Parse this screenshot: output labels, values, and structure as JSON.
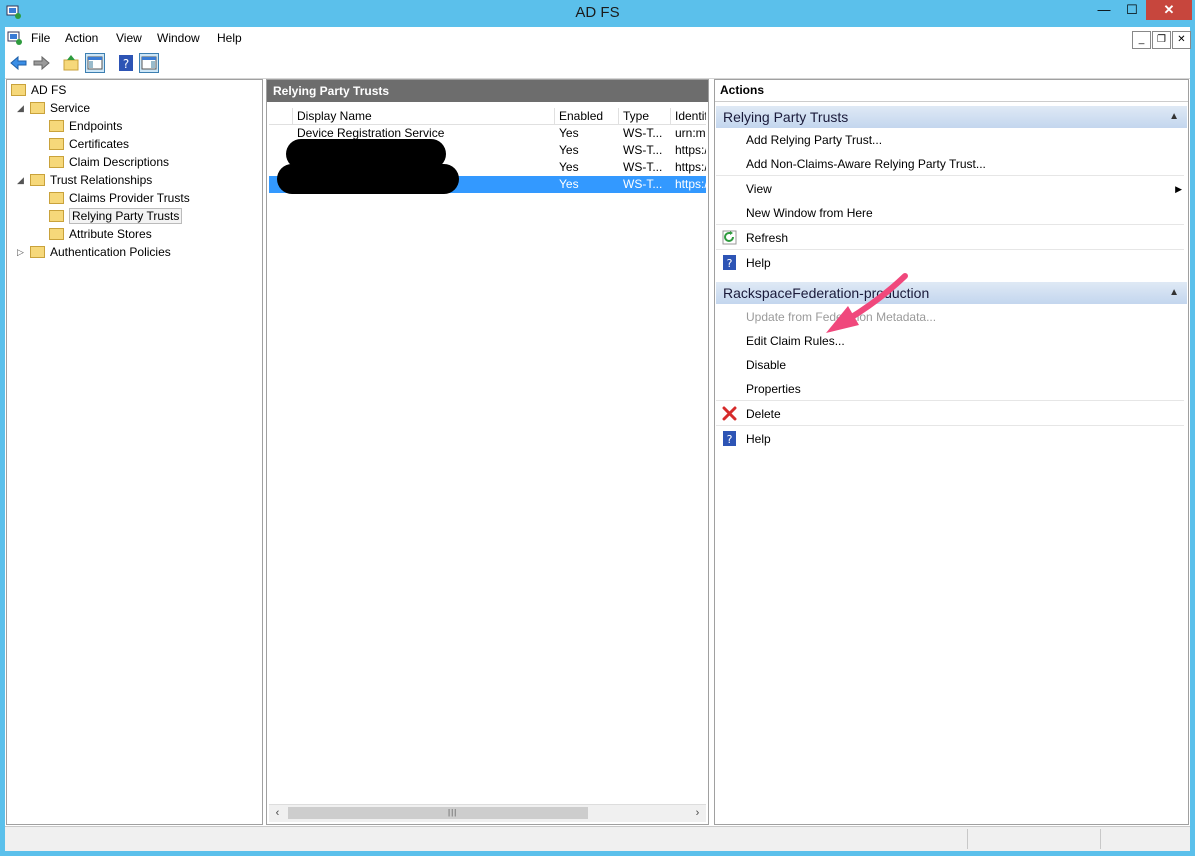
{
  "window": {
    "title": "AD FS"
  },
  "menu": [
    "File",
    "Action",
    "View",
    "Window",
    "Help"
  ],
  "tree": {
    "items": [
      {
        "label": "AD FS",
        "level": 0,
        "expander": ""
      },
      {
        "label": "Service",
        "level": 1,
        "expander": "expanded"
      },
      {
        "label": "Endpoints",
        "level": 2,
        "expander": ""
      },
      {
        "label": "Certificates",
        "level": 2,
        "expander": ""
      },
      {
        "label": "Claim Descriptions",
        "level": 2,
        "expander": ""
      },
      {
        "label": "Trust Relationships",
        "level": 1,
        "expander": "expanded"
      },
      {
        "label": "Claims Provider Trusts",
        "level": 2,
        "expander": ""
      },
      {
        "label": "Relying Party Trusts",
        "level": 2,
        "expander": "",
        "selected": true
      },
      {
        "label": "Attribute Stores",
        "level": 2,
        "expander": ""
      },
      {
        "label": "Authentication Policies",
        "level": 1,
        "expander": "collapsed"
      }
    ]
  },
  "center": {
    "title": "Relying Party Trusts",
    "columns": [
      "Display Name",
      "Enabled",
      "Type",
      "Identifi"
    ],
    "rows": [
      {
        "name": "Device Registration Service",
        "enabled": "Yes",
        "type": "WS-T...",
        "id": "urn:ms"
      },
      {
        "name": "",
        "enabled": "Yes",
        "type": "WS-T...",
        "id": "https:/"
      },
      {
        "name": "",
        "enabled": "Yes",
        "type": "WS-T...",
        "id": "https:/"
      },
      {
        "name": "",
        "enabled": "Yes",
        "type": "WS-T...",
        "id": "https:/",
        "selected": true
      }
    ]
  },
  "actions": {
    "title": "Actions",
    "sections": [
      {
        "header": "Relying Party Trusts",
        "items": [
          {
            "label": "Add Relying Party Trust...",
            "icon": ""
          },
          {
            "label": "Add Non-Claims-Aware Relying Party Trust...",
            "icon": "",
            "divider": true
          },
          {
            "label": "View",
            "icon": "",
            "submenu": true
          },
          {
            "label": "New Window from Here",
            "icon": "",
            "divider": true
          },
          {
            "label": "Refresh",
            "icon": "refresh-icon",
            "divider": true
          },
          {
            "label": "Help",
            "icon": "help-icon"
          }
        ]
      },
      {
        "header": "RackspaceFederation-production",
        "items": [
          {
            "label": "Update from Federation Metadata...",
            "icon": "",
            "disabled": true
          },
          {
            "label": "Edit Claim Rules...",
            "icon": ""
          },
          {
            "label": "Disable",
            "icon": ""
          },
          {
            "label": "Properties",
            "icon": "",
            "divider": true
          },
          {
            "label": "Delete",
            "icon": "delete-icon",
            "divider": true
          },
          {
            "label": "Help",
            "icon": "help-icon"
          }
        ]
      }
    ]
  },
  "colors": {
    "titlebar": "#5bc0eb",
    "selection": "#3399ff",
    "annotation_arrow": "#f0487c"
  }
}
